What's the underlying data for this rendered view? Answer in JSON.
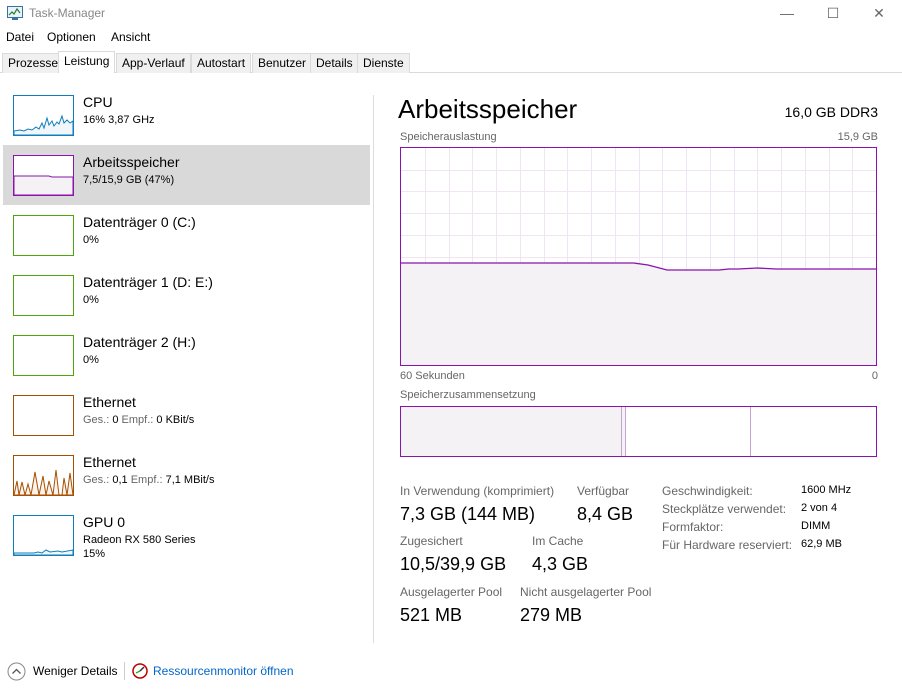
{
  "window": {
    "title": "Task-Manager",
    "minimize": "—",
    "maximize": "☐",
    "close": "✕"
  },
  "menu": [
    "Datei",
    "Optionen",
    "Ansicht"
  ],
  "tabs": [
    "Prozesse",
    "Leistung",
    "App-Verlauf",
    "Autostart",
    "Benutzer",
    "Details",
    "Dienste"
  ],
  "sidebar": {
    "items": [
      {
        "name": "CPU",
        "sub": "16%  3,87 GHz",
        "sub2": "",
        "color": "#117dbb",
        "icon": "cpu-graph"
      },
      {
        "name": "Arbeitsspeicher",
        "sub": "7,5/15,9 GB (47%)",
        "sub2": "",
        "color": "#8b12ae",
        "icon": "memory-graph"
      },
      {
        "name": "Datenträger 0 (C:)",
        "sub": "0%",
        "sub2": "",
        "color": "#4da60c",
        "icon": "disk-graph"
      },
      {
        "name": "Datenträger 1 (D: E:)",
        "sub": "0%",
        "sub2": "",
        "color": "#4da60c",
        "icon": "disk-graph"
      },
      {
        "name": "Datenträger 2 (H:)",
        "sub": "0%",
        "sub2": "",
        "color": "#4da60c",
        "icon": "disk-graph"
      },
      {
        "name": "Ethernet",
        "sub_label_send": "Ges.:",
        "sub_val_send": "0",
        "sub_label_recv": "Empf.:",
        "sub_val_recv": "0 KBit/s",
        "color": "#a74f01",
        "icon": "ethernet-graph"
      },
      {
        "name": "Ethernet",
        "sub_label_send": "Ges.:",
        "sub_val_send": "0,1",
        "sub_label_recv": "Empf.:",
        "sub_val_recv": "7,1 MBit/s",
        "color": "#a74f01",
        "icon": "ethernet-graph"
      },
      {
        "name": "GPU 0",
        "sub": "Radeon RX 580 Series",
        "sub2": "15%",
        "color": "#117dbb",
        "icon": "gpu-graph"
      }
    ]
  },
  "main": {
    "title": "Arbeitsspeicher",
    "spec": "16,0 GB DDR3",
    "graph_label": "Speicherauslastung",
    "graph_max": "15,9 GB",
    "graph_time_left": "60 Sekunden",
    "graph_time_right": "0",
    "usage_fraction": 0.47,
    "comp_label": "Speicherzusammensetzung",
    "stats": {
      "in_use_label": "In Verwendung (komprimiert)",
      "in_use_value": "7,3 GB (144 MB)",
      "available_label": "Verfügbar",
      "available_value": "8,4 GB",
      "committed_label": "Zugesichert",
      "committed_value": "10,5/39,9 GB",
      "cached_label": "Im Cache",
      "cached_value": "4,3 GB",
      "paged_label": "Ausgelagerter Pool",
      "paged_value": "521 MB",
      "nonpaged_label": "Nicht ausgelagerter Pool",
      "nonpaged_value": "279 MB"
    },
    "details": {
      "speed_label": "Geschwindigkeit:",
      "speed_value": "1600 MHz",
      "slots_label": "Steckplätze verwendet:",
      "slots_value": "2 von 4",
      "form_label": "Formfaktor:",
      "form_value": "DIMM",
      "reserved_label": "Für Hardware reserviert:",
      "reserved_value": "62,9 MB"
    }
  },
  "footer": {
    "fewer_details": "Weniger Details",
    "resource_monitor": "Ressourcenmonitor öffnen"
  },
  "colors": {
    "memory": "#8b12ae",
    "cpu": "#117dbb",
    "disk": "#4da60c",
    "ethernet": "#a74f01",
    "selected_bg": "#d9d9d9",
    "link": "#0066cc"
  }
}
